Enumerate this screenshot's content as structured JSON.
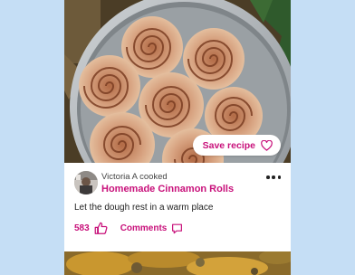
{
  "post": {
    "save_label": "Save recipe",
    "save_icon": "heart-outline-icon",
    "author_name": "Victoria A",
    "author_action": "cooked",
    "cooked_line": "Victoria A cooked",
    "recipe_title": "Homemade Cinnamon Rolls",
    "caption": "Let the dough rest in a warm place",
    "like_count": "583",
    "like_icon": "thumbs-up-icon",
    "comments_label": "Comments",
    "comments_icon": "speech-bubble-icon",
    "more_icon": "more-horizontal-icon"
  },
  "colors": {
    "page_background": "#c5def5",
    "accent": "#c8107a",
    "card_background": "#ffffff",
    "text": "#222222"
  }
}
